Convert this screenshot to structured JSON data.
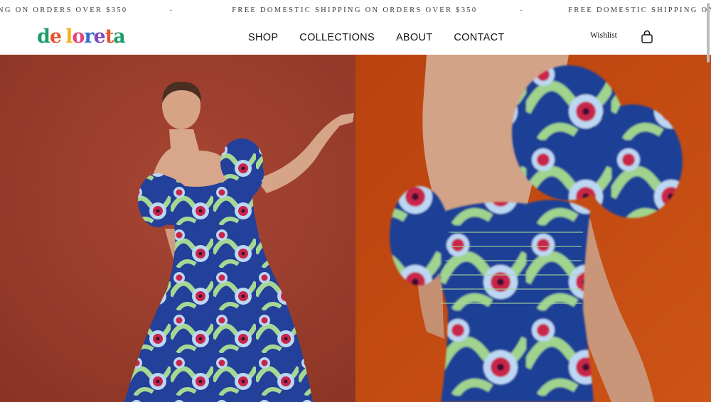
{
  "announcement": {
    "segments": [
      "NG ON ORDERS OVER $350",
      "-",
      "FREE DOMESTIC SHIPPING ON ORDERS OVER $350",
      "-",
      "FREE DOMESTIC SHIPPING ON ORDERS OV"
    ]
  },
  "logo": {
    "letters": [
      {
        "char": "d",
        "color": "#1c9d6a"
      },
      {
        "char": "e",
        "color": "#e6542c"
      },
      {
        "char": " ",
        "color": "#ffffff"
      },
      {
        "char": "l",
        "color": "#f2b21c"
      },
      {
        "char": "o",
        "color": "#e0457d"
      },
      {
        "char": "r",
        "color": "#2f6fd0"
      },
      {
        "char": "e",
        "color": "#7a4bc4"
      },
      {
        "char": "t",
        "color": "#e6542c"
      },
      {
        "char": "a",
        "color": "#1c9d6a"
      }
    ]
  },
  "nav": {
    "items": [
      "SHOP",
      "COLLECTIONS",
      "ABOUT",
      "CONTACT"
    ]
  },
  "header": {
    "wishlist_label": "Wishlist",
    "bag_icon": "shopping-bag-icon"
  },
  "hero": {
    "left_image": "model-in-floral-puff-sleeve-dress",
    "right_image": "back-of-floral-smocked-dress",
    "left_bg": "#9a3d2c",
    "right_bg": "#c04a12",
    "dress_colors": [
      "#1f3f96",
      "#9fd38e",
      "#c8254a",
      "#b9d6f5"
    ]
  }
}
